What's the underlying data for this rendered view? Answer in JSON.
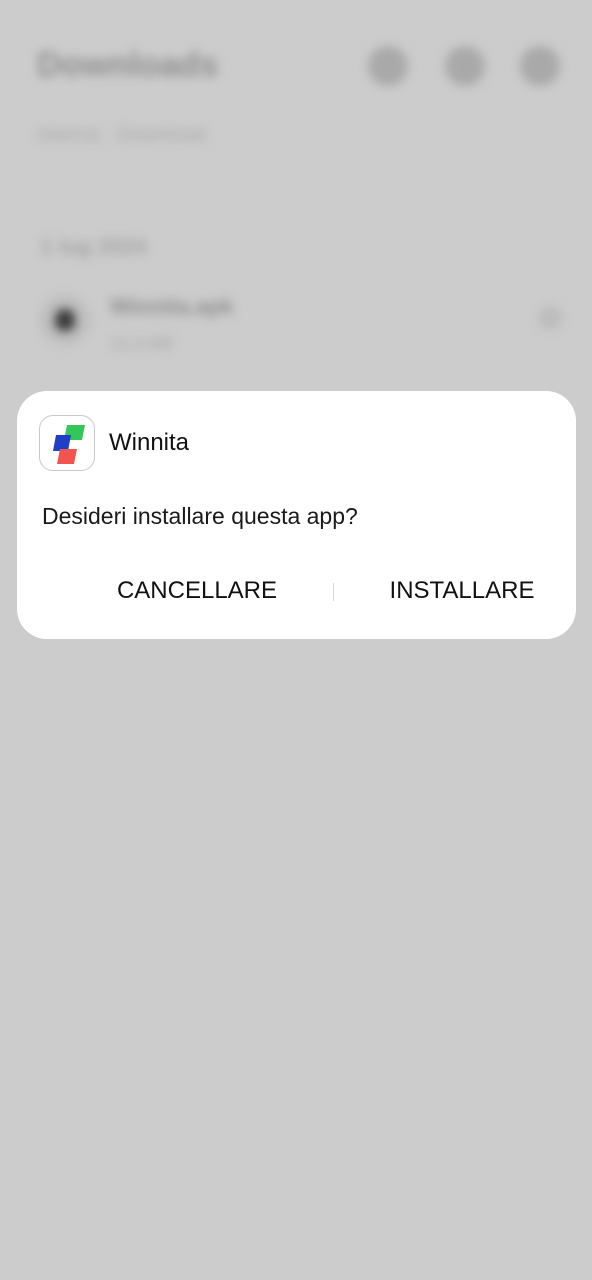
{
  "background": {
    "title": "Downloads",
    "path": "Interna · Download",
    "date_header": "1 lug 2024",
    "file": {
      "name": "Winnita.apk",
      "meta": "12,4 MB"
    }
  },
  "dialog": {
    "app_name": "Winnita",
    "question": "Desideri installare questa app?",
    "cancel_label": "CANCELLARE",
    "install_label": "INSTALLARE",
    "icon_colors": {
      "green": "#35c65a",
      "blue": "#1f3fc9",
      "red": "#f25450"
    }
  },
  "colors": {
    "scrim": "#cccccc",
    "dialog_bg": "#ffffff",
    "text": "#111111"
  }
}
